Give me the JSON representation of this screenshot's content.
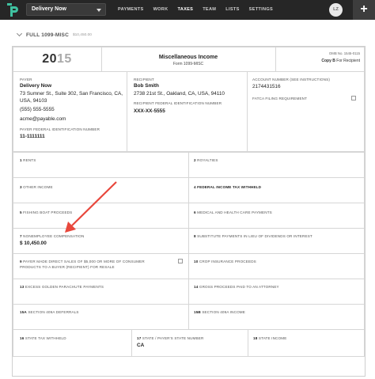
{
  "topbar": {
    "logo_icon": "p-logo-icon",
    "business_name": "Delivery Now",
    "nav": [
      {
        "label": "PAYMENTS",
        "active": false
      },
      {
        "label": "WORK",
        "active": false
      },
      {
        "label": "TAXES",
        "active": true
      },
      {
        "label": "TEAM",
        "active": false
      },
      {
        "label": "LISTS",
        "active": false
      },
      {
        "label": "SETTINGS",
        "active": false
      }
    ],
    "avatar_initials": "LZ",
    "plus_label": "+"
  },
  "section": {
    "title": "FULL 1099-MISC",
    "amount": "$10,450.00"
  },
  "form": {
    "year_prefix": "20",
    "year_suffix": "15",
    "title": "Miscellaneous Income",
    "subtitle": "Form 1099-MISC",
    "omb": "OMB No. 1545-0115",
    "copy_label": "Copy B",
    "copy_for": "For Recipient",
    "payer": {
      "label": "PAYER",
      "name": "Delivery Now",
      "address1": "73 Sumner St., Suite 302, San Francisco, CA,",
      "address2": "USA, 94103",
      "phone": "(555) 555-5555",
      "email": "acme@payable.com",
      "fed_id_label": "PAYER FEDERAL IDENTIFICATION NUMBER",
      "fed_id": "11-1111111"
    },
    "recipient": {
      "label": "RECIPIENT",
      "name": "Bob Smith",
      "address": "2738 21st St., Oakland, CA, USA, 94110",
      "fed_id_label": "RECIPIENT FEDERAL IDENTIFICATION NUMBER",
      "fed_id": "XXX-XX-5555"
    },
    "account": {
      "label": "ACCOUNT NUMBER (SEE INSTRUCTIONS)",
      "value": "2174431516",
      "fatca_label": "FATCA FILING REQUIREMENT"
    },
    "boxes": {
      "b1": {
        "num": "1",
        "label": "RENTS",
        "value": ""
      },
      "b2": {
        "num": "2",
        "label": "ROYALTIES",
        "value": ""
      },
      "b3": {
        "num": "3",
        "label": "OTHER INCOME",
        "value": ""
      },
      "b4": {
        "num": "4",
        "label": "FEDERAL INCOME TAX WITHHELD",
        "value": ""
      },
      "b5": {
        "num": "5",
        "label": "FISHING BOAT PROCEEDS",
        "value": ""
      },
      "b6": {
        "num": "6",
        "label": "MEDICAL AND HEALTH CARE PAYMENTS",
        "value": ""
      },
      "b7": {
        "num": "7",
        "label": "NONEMPLOYEE COMPENSATION",
        "value": "$ 10,450.00"
      },
      "b8": {
        "num": "8",
        "label": "SUBSTITUTE PAYMENTS IN LIEU OF DIVIDENDS OR INTEREST",
        "value": ""
      },
      "b9": {
        "num": "9",
        "label": "PAYER MADE DIRECT SALES OF $5,000 OR MORE OF CONSUMER",
        "label2": "PRODUCTS TO A BUYER (RECIPIENT) FOR RESALE",
        "value": ""
      },
      "b10": {
        "num": "10",
        "label": "CROP INSURANCE PROCEEDS",
        "value": ""
      },
      "b13": {
        "num": "13",
        "label": "EXCESS GOLDEN PARACHUTE PAYMENTS",
        "value": ""
      },
      "b14": {
        "num": "14",
        "label": "GROSS PROCEEDS PAID TO AN ATTORNEY",
        "value": ""
      },
      "b15a": {
        "num": "15a",
        "label": "SECTION 409A DEFERRALS",
        "value": ""
      },
      "b15b": {
        "num": "15b",
        "label": "SECTION 409A INCOME",
        "value": ""
      },
      "b16": {
        "num": "16",
        "label": "STATE TAX WITHHELD",
        "value": ""
      },
      "b17": {
        "num": "17",
        "label": "STATE / PAYER'S STATE NUMBER",
        "value": "CA"
      },
      "b18": {
        "num": "18",
        "label": "STATE INCOME",
        "value": ""
      }
    }
  },
  "annotation": {
    "arrow_color": "#e8473c"
  }
}
